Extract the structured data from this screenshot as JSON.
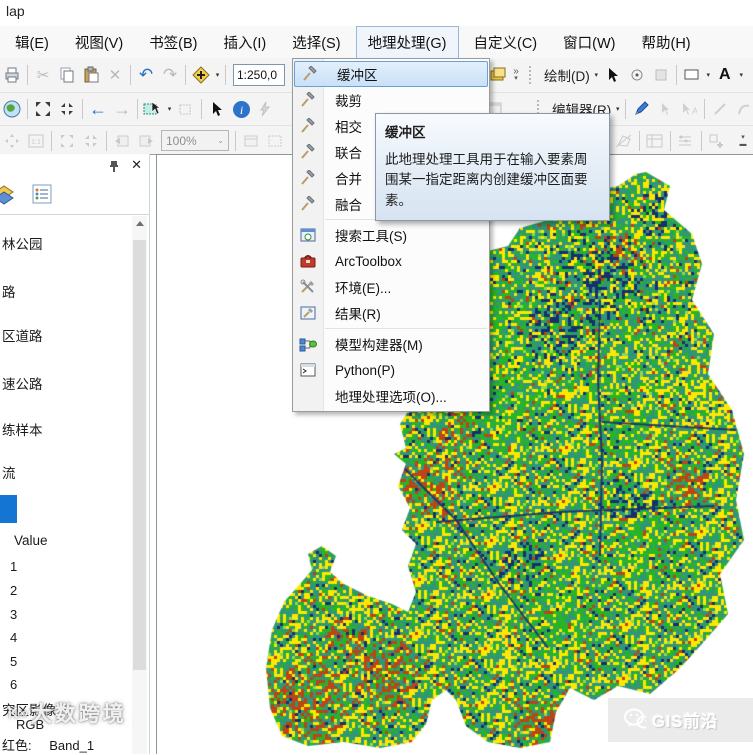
{
  "window": {
    "title": "lap"
  },
  "menubar": {
    "items": [
      "辑(E)",
      "视图(V)",
      "书签(B)",
      "插入(I)",
      "选择(S)",
      "地理处理(G)",
      "自定义(C)",
      "窗口(W)",
      "帮助(H)"
    ],
    "active": "地理处理(G)"
  },
  "toolbar": {
    "scale_value": "1:250,0",
    "draw_label": "绘制(D)",
    "text_tool_label": "A",
    "editor_label": "编辑器(R)",
    "layout_zoom_value": "100%",
    "overflow_chevron": "»"
  },
  "gp_menu": {
    "items": [
      {
        "label": "缓冲区",
        "icon": "hammer-icon",
        "highlighted": true
      },
      {
        "label": "裁剪",
        "icon": "hammer-icon"
      },
      {
        "label": "相交",
        "icon": "hammer-icon"
      },
      {
        "label": "联合",
        "icon": "hammer-icon"
      },
      {
        "label": "合并",
        "icon": "hammer-icon"
      },
      {
        "label": "融合",
        "icon": "hammer-icon"
      },
      {
        "label": "搜索工具(S)",
        "icon": "search-window-icon"
      },
      {
        "label": "ArcToolbox",
        "icon": "toolbox-icon"
      },
      {
        "label": "环境(E)...",
        "icon": "environment-icon"
      },
      {
        "label": "结果(R)",
        "icon": "results-icon"
      },
      {
        "label": "模型构建器(M)",
        "icon": "modelbuilder-icon"
      },
      {
        "label": "Python(P)",
        "icon": "python-icon"
      },
      {
        "label": "地理处理选项(O)...",
        "icon": "none"
      }
    ]
  },
  "tooltip": {
    "title": "缓冲区",
    "body": "此地理处理工具用于在输入要素周围某一指定距离内创建缓冲区面要素。"
  },
  "toc": {
    "layers": [
      "林公园",
      "路",
      "区道路",
      "速公路",
      "练样本",
      "流"
    ],
    "value_label": "Value",
    "legend_values": [
      "1",
      "2",
      "3",
      "4",
      "5",
      "6"
    ],
    "raster_layer": "究区影像.tif",
    "raster_composite": "RGB",
    "raster_band_prefix": "红色:",
    "raster_band": "Band_1"
  },
  "watermarks": {
    "left_logo": "K∞",
    "left_text": "大数跨境",
    "right_text": "GIS前沿"
  },
  "map": {
    "palette": {
      "teal": "#2f9677",
      "green": "#27b427",
      "yellow": "#ffe800",
      "navy": "#16306e",
      "red": "#bc4416",
      "light_green": "#8fd94d"
    },
    "road_color": "#1b2f6e"
  }
}
